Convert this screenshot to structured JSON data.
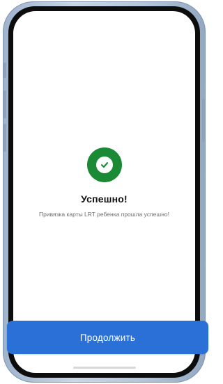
{
  "screen": {
    "title": "Успешно!",
    "message": "Привязка карты LRT ребенка прошла успешно!",
    "status_icon": "check-circle-icon"
  },
  "actions": {
    "continue_label": "Продолжить"
  },
  "colors": {
    "success": "#1a8a35",
    "primary_button": "#2a70d6",
    "text_primary": "#111111",
    "text_secondary": "#6f6f6f"
  }
}
